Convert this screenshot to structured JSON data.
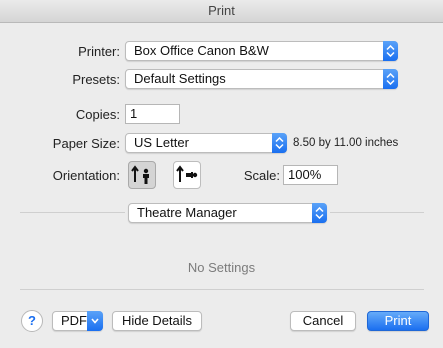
{
  "window": {
    "title": "Print"
  },
  "printer": {
    "label": "Printer:",
    "value": "Box Office Canon B&W"
  },
  "presets": {
    "label": "Presets:",
    "value": "Default Settings"
  },
  "copies": {
    "label": "Copies:",
    "value": "1"
  },
  "paper": {
    "label": "Paper Size:",
    "value": "US Letter",
    "dimensions": "8.50 by 11.00 inches"
  },
  "orientation": {
    "label": "Orientation:",
    "selected": "portrait"
  },
  "scale": {
    "label": "Scale:",
    "value": "100%"
  },
  "section": {
    "value": "Theatre Manager",
    "empty_text": "No Settings"
  },
  "footer": {
    "help_label": "?",
    "pdf_label": "PDF",
    "details_label": "Hide Details",
    "cancel_label": "Cancel",
    "print_label": "Print"
  },
  "colors": {
    "accent": "#1b6ff0",
    "window_bg": "#ececec"
  },
  "icons": [
    "up-down-arrows-icon",
    "portrait-orientation-icon",
    "landscape-orientation-icon",
    "chevron-down-icon",
    "help-icon"
  ]
}
